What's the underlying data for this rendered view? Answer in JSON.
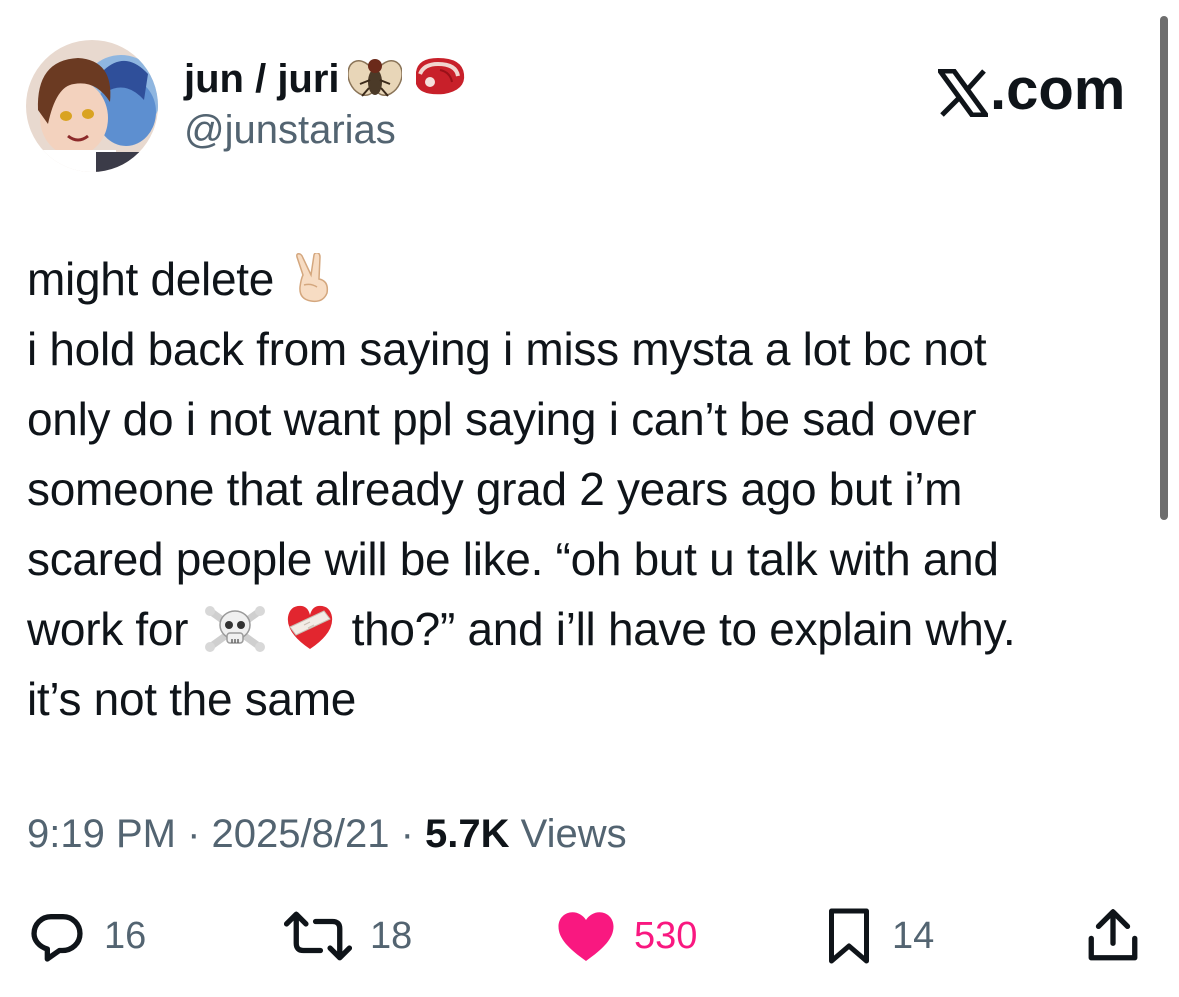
{
  "author": {
    "display_name": "jun / juri",
    "name_emojis": [
      "fly-emoji",
      "meat-emoji"
    ],
    "handle": "@junstarias",
    "avatar": "anime-avatar"
  },
  "brand": {
    "label": ".com",
    "logo": "x-logo"
  },
  "tweet": {
    "lines": [
      "might delete",
      "i hold back from saying i miss mysta a lot bc not",
      "only do i not want ppl saying i can’t be sad over",
      "someone that already grad 2 years ago but i’m",
      "scared people will be like. “oh but u talk with and",
      "work for",
      "tho?” and i’ll have to explain why.",
      "it’s not the same"
    ],
    "emojis": [
      "victory-hand-emoji",
      "skull-crossbones-emoji",
      "mending-heart-emoji"
    ]
  },
  "meta": {
    "time": "9:19 PM",
    "sep1": " · ",
    "date": "2025/8/21",
    "sep2": " · ",
    "views_count": "5.7K",
    "views_label": " Views"
  },
  "actions": {
    "replies": "16",
    "reposts": "18",
    "likes": "530",
    "bookmarks": "14"
  },
  "colors": {
    "text": "#0f1419",
    "secondary": "#536471",
    "like": "#f91880"
  }
}
